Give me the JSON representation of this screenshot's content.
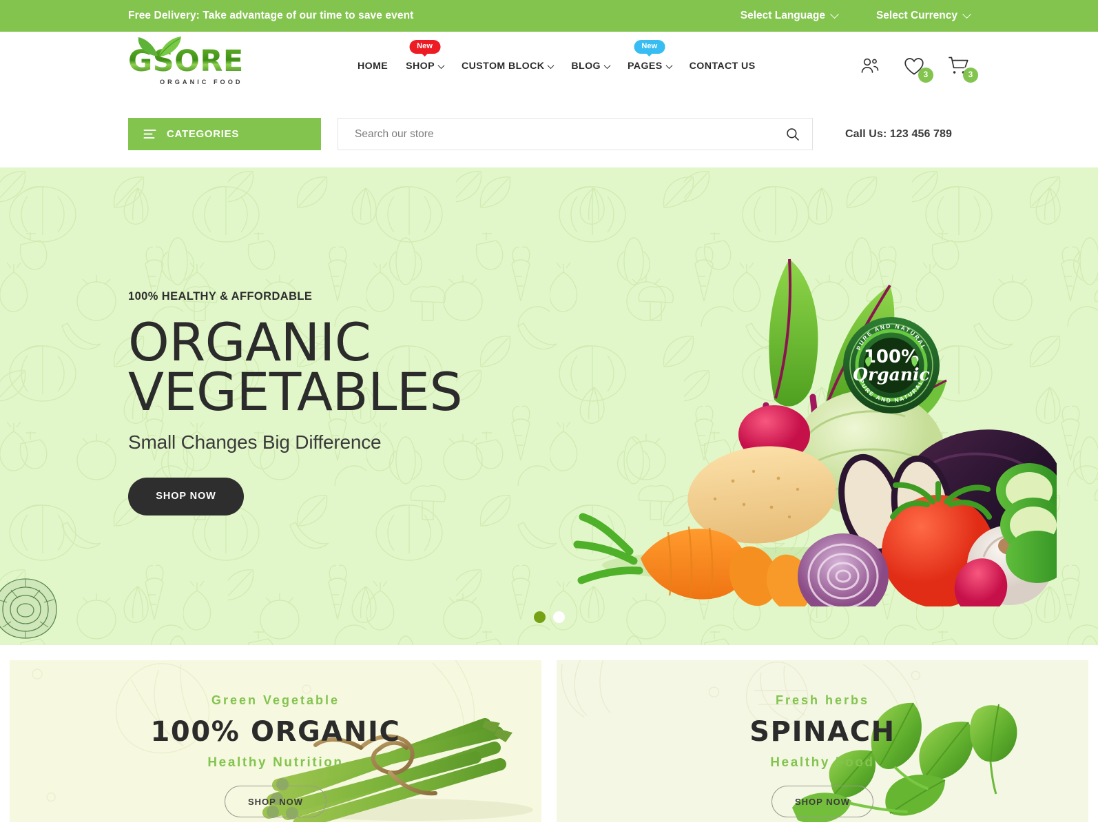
{
  "topbar": {
    "message": "Free Delivery: Take advantage of our time to save event",
    "language_label": "Select Language",
    "currency_label": "Select Currency",
    "bg_color": "#83c44e"
  },
  "header": {
    "logo": {
      "word": "GSORE",
      "tagline": "ORGANIC FOOD"
    },
    "nav": [
      {
        "label": "HOME",
        "has_dropdown": false,
        "badge": null
      },
      {
        "label": "SHOP",
        "has_dropdown": true,
        "badge": "New",
        "badge_color": "#ed1b24"
      },
      {
        "label": "CUSTOM BLOCK",
        "has_dropdown": true,
        "badge": null
      },
      {
        "label": "BLOG",
        "has_dropdown": true,
        "badge": null
      },
      {
        "label": "PAGES",
        "has_dropdown": true,
        "badge": "New",
        "badge_color": "#37bdf2"
      },
      {
        "label": "CONTACT US",
        "has_dropdown": false,
        "badge": null
      }
    ],
    "icons": {
      "account": "users-icon",
      "wishlist": "heart-icon",
      "wishlist_count": "3",
      "cart": "cart-icon",
      "cart_count": "3",
      "badge_color": "#83c44e"
    }
  },
  "searchbar": {
    "categories_label": "CATEGORIES",
    "search_placeholder": "Search our store",
    "search_value": "",
    "call_us": "Call Us: 123 456 789"
  },
  "hero": {
    "eyebrow": "100% HEALTHY & AFFORDABLE",
    "title_line1": "ORGANIC",
    "title_line2": "VEGETABLES",
    "subtitle": "Small Changes Big Difference",
    "cta": "SHOP NOW",
    "bg_color": "#e2f7c9",
    "badge": {
      "top_text": "PURE AND NATURAL",
      "bottom_text": "PURE AND NATURAL",
      "percent": "100%",
      "word": "Organic"
    },
    "slides": [
      {
        "active": true
      },
      {
        "active": false
      }
    ]
  },
  "promos": [
    {
      "eyebrow": "Green Vegetable",
      "title": "100% ORGANIC",
      "kicker": "Healthy Nutrition",
      "button": "SHOP NOW",
      "art": "asparagus-bundle",
      "bg_color": "#f6f8e0"
    },
    {
      "eyebrow": "Fresh herbs",
      "title": "SPINACH",
      "kicker": "Healthy Food",
      "button": "SHOP NOW",
      "art": "spinach-leaves",
      "bg_color": "#f4f7e4"
    }
  ]
}
